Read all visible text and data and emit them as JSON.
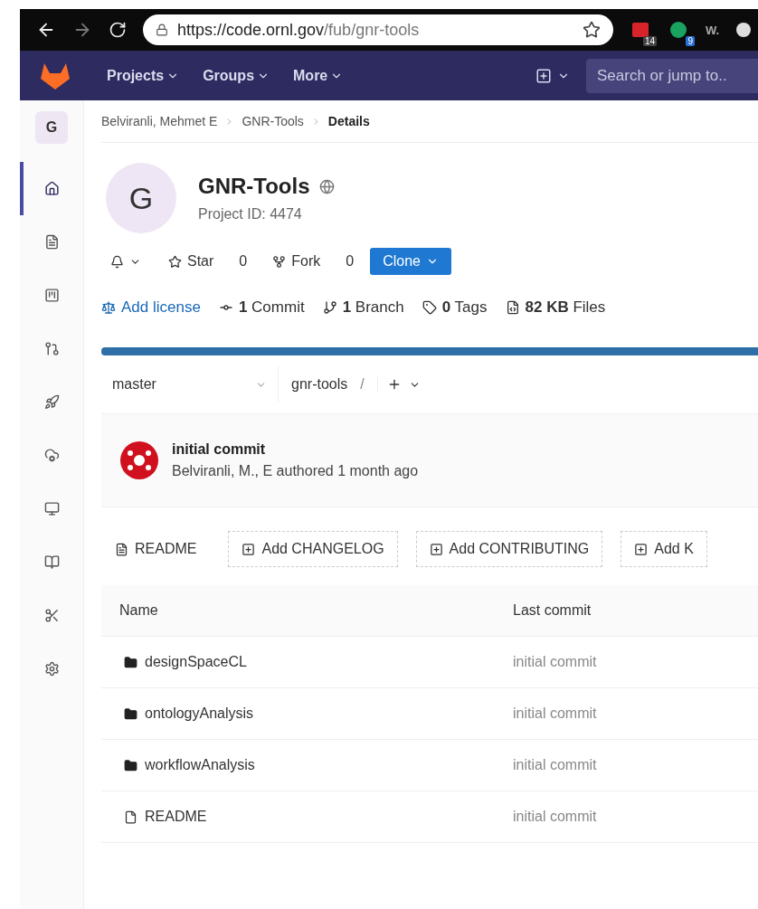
{
  "browser": {
    "url_host": "https://code.ornl.gov",
    "url_path": "/fub/gnr-tools",
    "extensions": [
      {
        "kind": "calendar",
        "badge": "14"
      },
      {
        "kind": "dot",
        "badge": "9"
      },
      {
        "kind": "text",
        "label": "W."
      },
      {
        "kind": "circle"
      }
    ]
  },
  "navbar": {
    "menus": [
      "Projects",
      "Groups",
      "More"
    ],
    "search": {
      "placeholder": "Search or jump to.."
    }
  },
  "sidebar": {
    "project_letter": "G",
    "items": [
      {
        "kind": "home",
        "selected": true
      },
      {
        "kind": "file",
        "selected": false
      },
      {
        "kind": "issues",
        "selected": false
      },
      {
        "kind": "merge",
        "selected": false
      },
      {
        "kind": "rocket",
        "selected": false
      },
      {
        "kind": "ops",
        "selected": false
      },
      {
        "kind": "monitor",
        "selected": false
      },
      {
        "kind": "wiki",
        "selected": false
      },
      {
        "kind": "snippets",
        "selected": false
      },
      {
        "kind": "settings",
        "selected": false
      }
    ]
  },
  "breadcrumbs": [
    {
      "label": "Belviranli, Mehmet E",
      "current": false
    },
    {
      "label": "GNR-Tools",
      "current": false
    },
    {
      "label": "Details",
      "current": true
    }
  ],
  "project": {
    "avatar_letter": "G",
    "name": "GNR-Tools",
    "id_text": "Project ID: 4474",
    "star": {
      "label": "Star",
      "count": "0"
    },
    "fork": {
      "label": "Fork",
      "count": "0"
    },
    "clone": "Clone"
  },
  "stats": [
    {
      "kind": "license",
      "text": "Add license"
    },
    {
      "kind": "commit",
      "text": "**1** Commit"
    },
    {
      "kind": "branch",
      "text": "**1** Branch"
    },
    {
      "kind": "tag",
      "text": "**0** Tags"
    },
    {
      "kind": "files",
      "text": "**82 KB** Files"
    }
  ],
  "repo": {
    "branch": "master",
    "path": "gnr-tools",
    "separator": "/"
  },
  "last_commit": {
    "title": "initial commit",
    "meta": "Belviranli, M., E authored 1 month ago"
  },
  "file_buttons": [
    {
      "kind": "existing",
      "label": "README"
    },
    {
      "kind": "add",
      "label": "Add CHANGELOG"
    },
    {
      "kind": "add",
      "label": "Add CONTRIBUTING"
    },
    {
      "kind": "add",
      "label": "Add K"
    }
  ],
  "table": {
    "columns": [
      "Name",
      "Last commit"
    ],
    "rows": [
      {
        "kind": "folder",
        "name": "designSpaceCL",
        "last_commit": "initial commit"
      },
      {
        "kind": "folder",
        "name": "ontologyAnalysis",
        "last_commit": "initial commit"
      },
      {
        "kind": "folder",
        "name": "workflowAnalysis",
        "last_commit": "initial commit"
      },
      {
        "kind": "file",
        "name": "README",
        "last_commit": "initial commit"
      }
    ]
  }
}
